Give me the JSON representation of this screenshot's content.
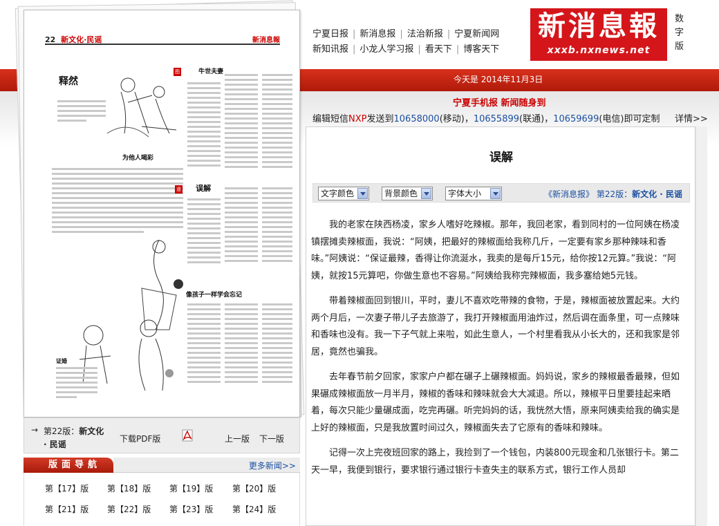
{
  "header": {
    "nav_row1": [
      "宁夏日报",
      "新消息报",
      "法治新报",
      "宁夏新闻网"
    ],
    "nav_row2": [
      "新知讯报",
      "小龙人学习报",
      "看天下",
      "博客天下"
    ],
    "logo_text": "新消息報",
    "logo_url": "xxxb.nxnews.net",
    "digital_label": "数字版"
  },
  "date_line": "今天是  2014年11月3日",
  "mobile_promo": "宁夏手机报  新闻随身到",
  "sms": {
    "prefix": "编辑短信",
    "code": "NXP",
    "mid": "发送到",
    "n1": "10658000",
    "c1": "(移动)，",
    "n2": "10655899",
    "c2": "(联通)，",
    "n3": "10659699",
    "c3": "(电信)即可定制",
    "detail": "详情>>"
  },
  "paper_preview": {
    "page_no": "22",
    "section": "新文化·民谣",
    "brand": "新消息報",
    "titles": [
      "释然",
      "为他人喝彩",
      "牛世夫妻",
      "误解",
      "像孩子一样学会忘记",
      "证婚"
    ]
  },
  "pager": {
    "edition_prefix": "第22版：",
    "edition_name": "新文化",
    "edition_name2": "· 民谣",
    "pdf": "下载PDF版",
    "prev": "上一版",
    "next": "下一版"
  },
  "layout_nav": {
    "title": "版面导航",
    "more": "更多新闻>>",
    "pages": [
      "第【17】版",
      "第【18】版",
      "第【19】版",
      "第【20】版",
      "第【21】版",
      "第【22】版",
      "第【23】版",
      "第【24】版"
    ]
  },
  "article": {
    "title": "误解",
    "toolbar": {
      "text_color": "文字颜色",
      "bg_color": "背景颜色",
      "font_size": "字体大小",
      "crumb_paper": "《新消息报》",
      "crumb_page": "第22版：",
      "crumb_section": "新文化 · 民谣"
    },
    "paragraphs": [
      "我的老家在陕西杨凌，家乡人嗜好吃辣椒。那年，我回老家，看到同村的一位阿姨在杨凌镇摆摊卖辣椒面，我说：“阿姨，把最好的辣椒面给我称几斤，一定要有家乡那种辣味和香味。”阿姨说：“保证最辣，香得让你流涎水，我卖的是每斤15元，给你按12元算。”我说：“阿姨，就按15元算吧，你做生意也不容易。”阿姨给我称完辣椒面，我多塞给她5元钱。",
      "带着辣椒面回到银川，平时，妻儿不喜欢吃带辣的食物，于是，辣椒面被放置起来。大约两个月后，一次妻子带儿子去旅游了，我打开辣椒面用油炸过，然后调在面条里，可一点辣味和香味也没有。我一下子气就上来啦，如此生意人，一个村里看我从小长大的，还和我家是邻居，竟然也骗我。",
      "去年春节前夕回家，家家户户都在碾子上碾辣椒面。妈妈说，家乡的辣椒最香最辣，但如果碾成辣椒面放一月半月，辣椒的香味和辣味就会大大减退。所以，辣椒平日里要挂起来晒着，每次只能少量碾成面，吃完再碾。听完妈妈的话，我恍然大悟，原来阿姨卖给我的确实是上好的辣椒面，只是我放置时间过久，辣椒面失去了它原有的香味和辣味。",
      "记得一次上完夜班回家的路上，我捡到了一个钱包，内装800元现金和几张银行卡。第二天一早，我便到银行，要求银行通过银行卡查失主的联系方式，银行工作人员却"
    ]
  }
}
